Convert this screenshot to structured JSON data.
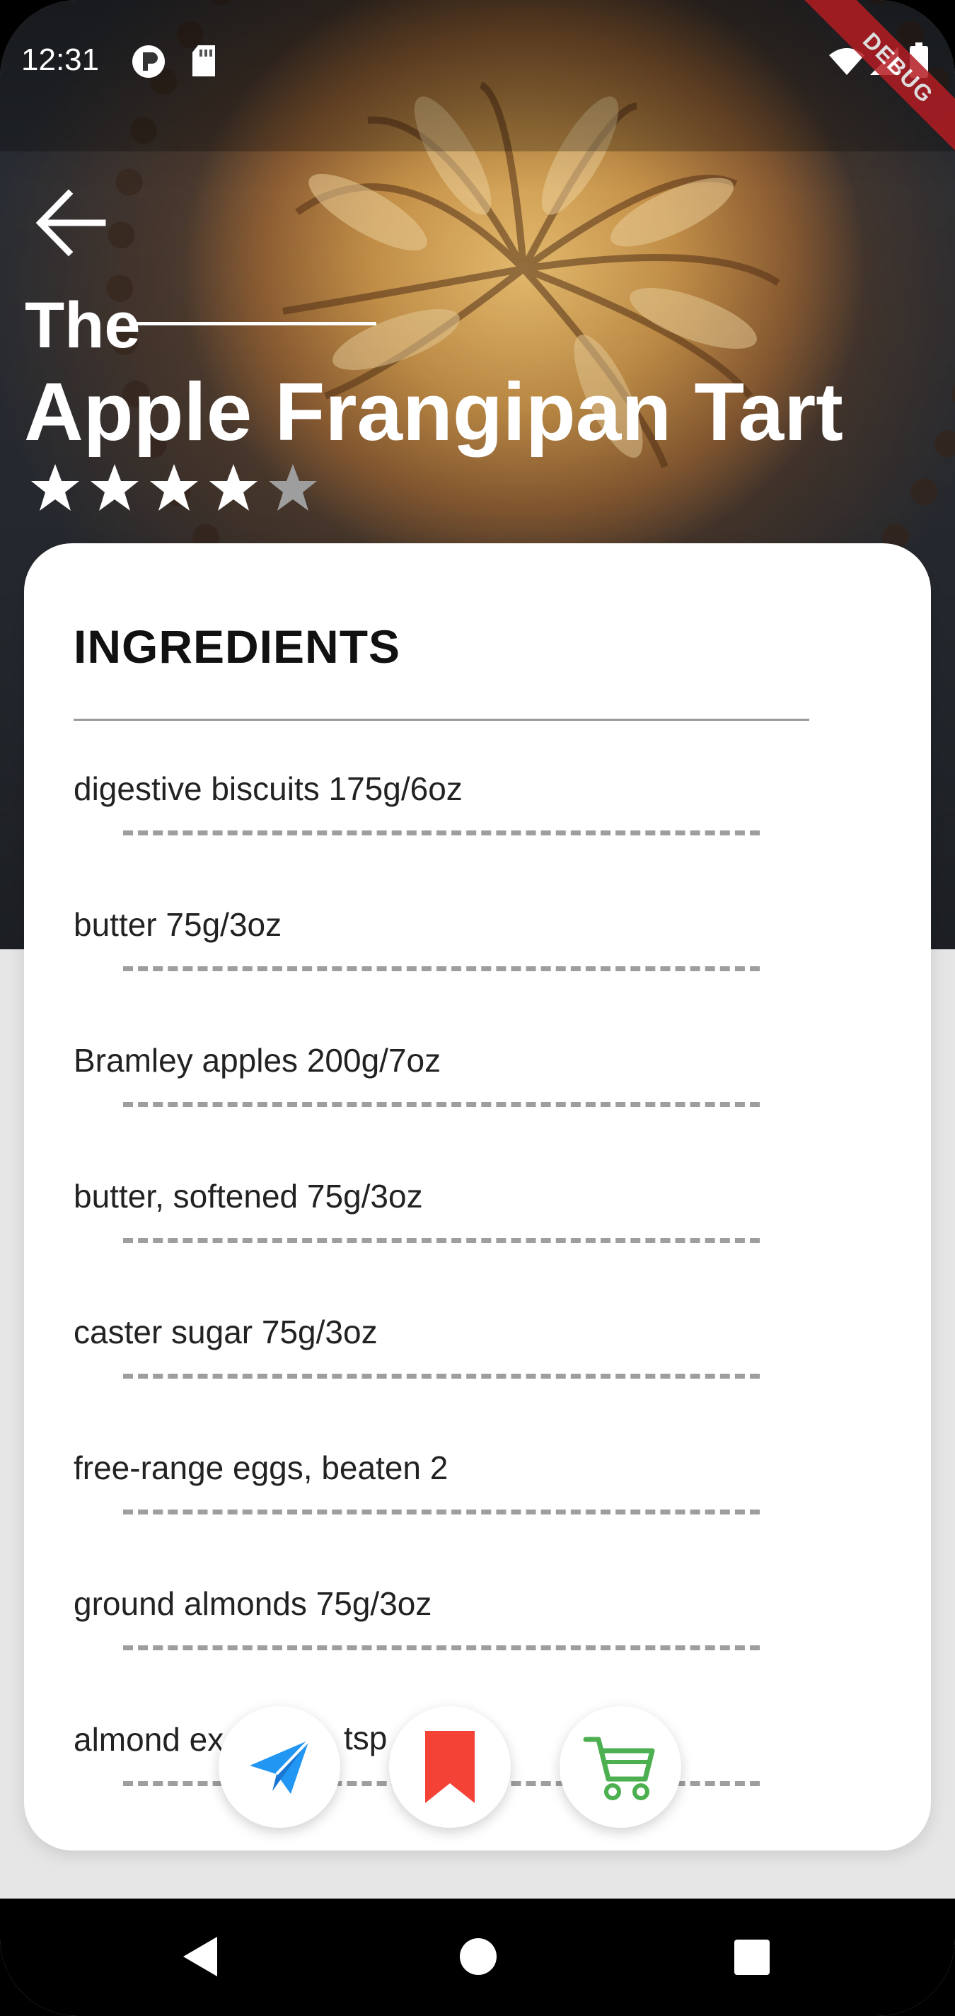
{
  "status_bar": {
    "time": "12:31",
    "icons": [
      "p-badge-icon",
      "sd-card-icon",
      "wifi-icon",
      "signal-icon",
      "battery-icon"
    ],
    "debug_label": "DEBUG"
  },
  "header": {
    "back_icon": "arrow-left-icon",
    "title_prefix": "The",
    "title": "Apple Frangipan Tart",
    "rating": 4,
    "rating_max": 5,
    "star_color": "#ffffff",
    "star_empty_color": "#9e9e9e"
  },
  "ingredients": {
    "heading": "INGREDIENTS",
    "items": [
      {
        "text": "digestive biscuits  175g/6oz"
      },
      {
        "text": "butter  75g/3oz"
      },
      {
        "text": "Bramley apples  200g/7oz"
      },
      {
        "text": "butter, softened  75g/3oz"
      },
      {
        "text": "caster sugar  75g/3oz"
      },
      {
        "text": "free-range eggs, beaten  2"
      },
      {
        "text": "ground almonds  75g/3oz"
      },
      {
        "text": "almond ex"
      }
    ],
    "partial_visible_fragment": "tsp"
  },
  "actions": [
    {
      "name": "share-button",
      "icon": "paper-plane-icon",
      "color": "#2196f3"
    },
    {
      "name": "bookmark-button",
      "icon": "bookmark-icon",
      "color": "#f44336"
    },
    {
      "name": "cart-button",
      "icon": "shopping-cart-icon",
      "color": "#4caf50"
    }
  ],
  "nav_bar": {
    "buttons": [
      "back-triangle-icon",
      "home-circle-icon",
      "recents-square-icon"
    ]
  }
}
